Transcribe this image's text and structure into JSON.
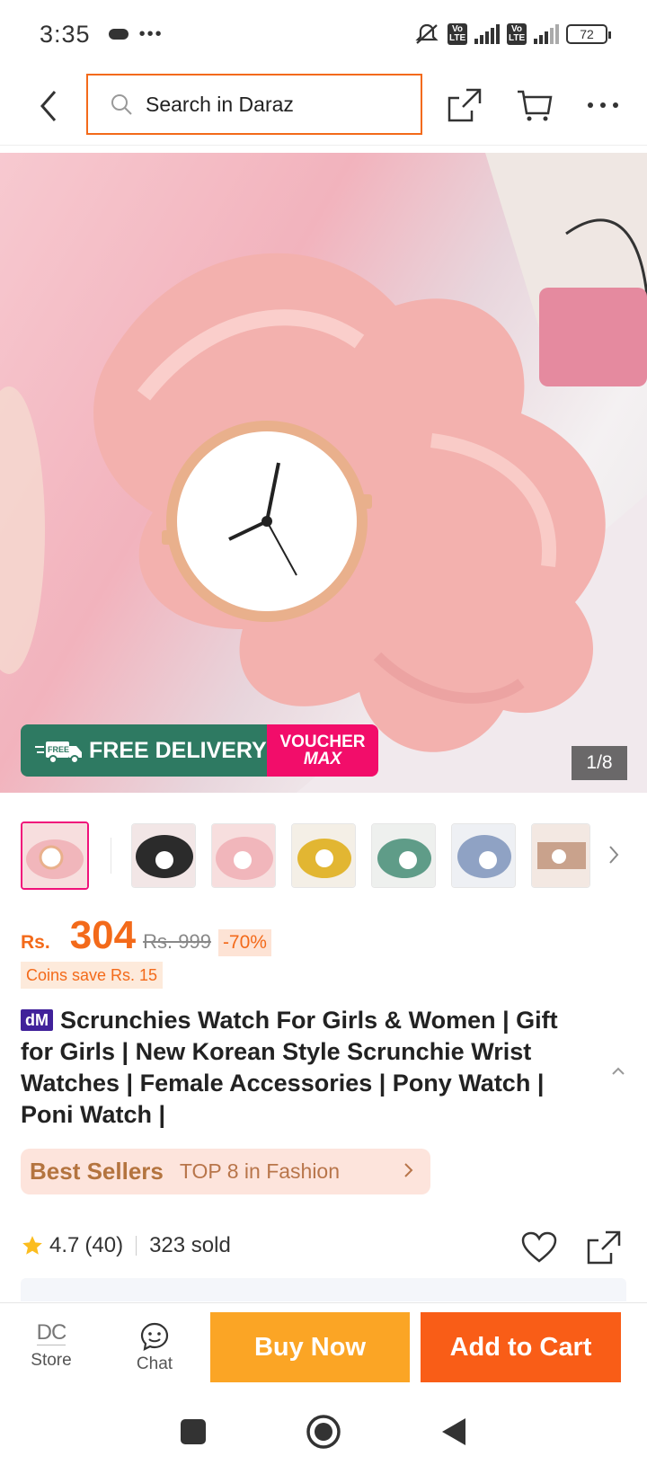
{
  "status_bar": {
    "time": "3:35",
    "battery": "72",
    "lte_1": "Vo LTE",
    "lte_2": "Vo LTE"
  },
  "header": {
    "search_placeholder": "Search in Daraz"
  },
  "gallery": {
    "counter": "1/8",
    "banner_left": "FREE DELIVERY",
    "banner_free_tag": "FREE",
    "banner_right_1": "VOUCHER",
    "banner_right_2": "MAX"
  },
  "thumbnails": [
    {
      "color": "#f1b6bb",
      "selected": true
    },
    {
      "color": "#2b2b2b",
      "selected": false
    },
    {
      "color": "#f1b6bb",
      "selected": false
    },
    {
      "color": "#e2b632",
      "selected": false
    },
    {
      "color": "#5f9c88",
      "selected": false
    },
    {
      "color": "#8fa2c4",
      "selected": false
    },
    {
      "color": "#c9a28c",
      "selected": false
    }
  ],
  "price": {
    "currency": "Rs.",
    "value": "304",
    "original": "Rs. 999",
    "discount": "-70%"
  },
  "coins": "Coins save Rs. 15",
  "product": {
    "badge": "dM",
    "title": "Scrunchies Watch For Girls & Women | Gift for Girls | New Korean Style Scrunchie Wrist Watches | Female Accessories | Pony Watch | Poni Watch |"
  },
  "best_sellers": {
    "label": "Best Sellers",
    "rank": "TOP 8 in Fashion"
  },
  "rating": {
    "score": "4.7",
    "count": "(40)",
    "sold": "323 sold"
  },
  "bottom_bar": {
    "store": "Store",
    "store_logo": "DC",
    "chat": "Chat",
    "buy_now": "Buy Now",
    "add_to_cart": "Add to Cart"
  },
  "colors": {
    "accent": "#f36a1a",
    "buy_now": "#fba525",
    "add_to_cart": "#f95d17"
  }
}
